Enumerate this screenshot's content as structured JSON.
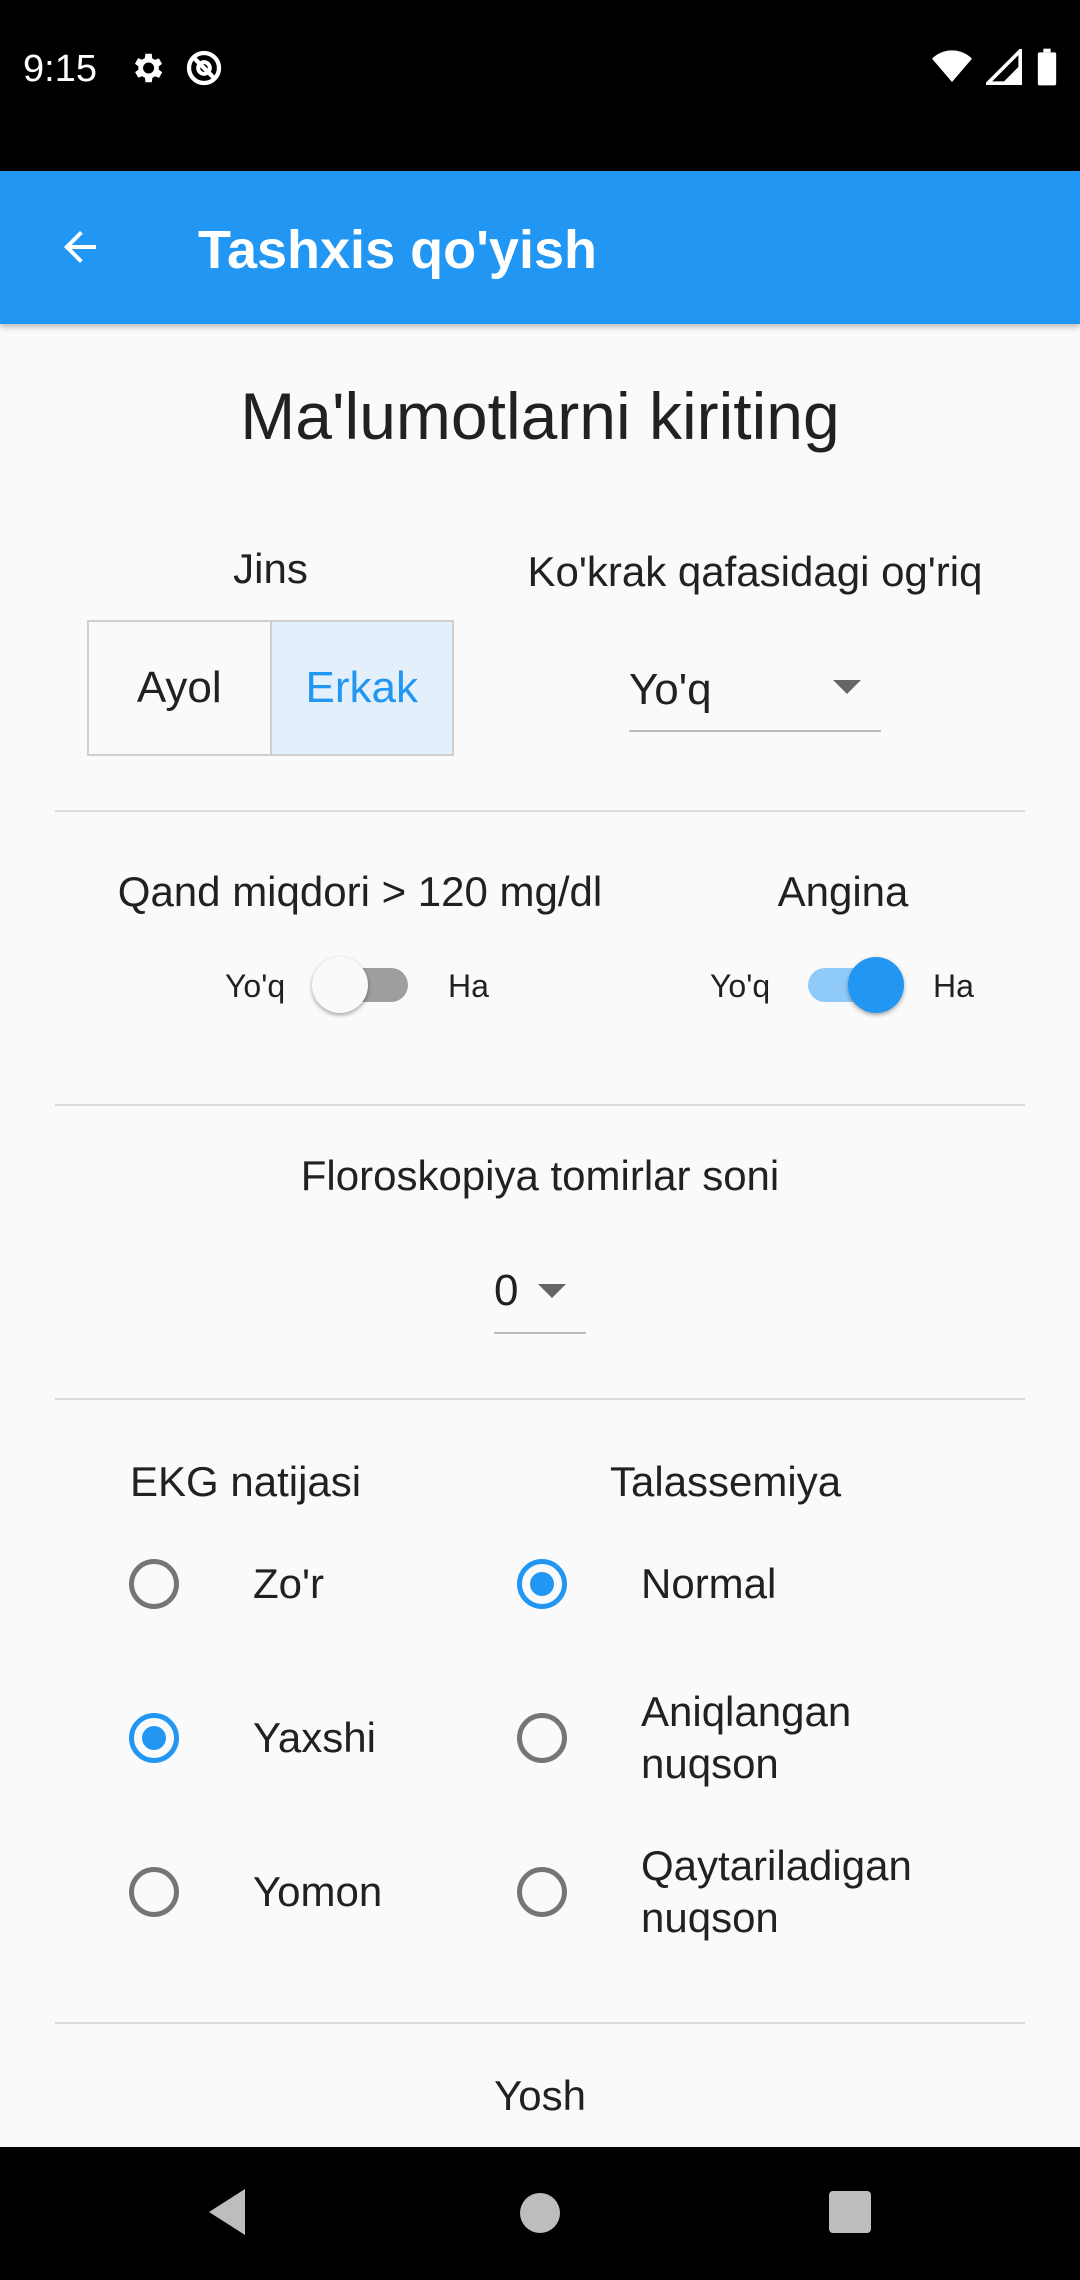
{
  "status_bar": {
    "time": "9:15"
  },
  "app_bar": {
    "title": "Tashxis qo'yish"
  },
  "heading": "Ma'lumotlarni kiriting",
  "gender": {
    "label": "Jins",
    "options": [
      "Ayol",
      "Erkak"
    ],
    "selected": "Erkak"
  },
  "chest_pain": {
    "label": "Ko'krak qafasidagi og'riq",
    "value": "Yo'q"
  },
  "sugar": {
    "label": "Qand miqdori > 120 mg/dl",
    "off_label": "Yo'q",
    "on_label": "Ha",
    "checked": false
  },
  "angina": {
    "label": "Angina",
    "off_label": "Yo'q",
    "on_label": "Ha",
    "checked": true
  },
  "vessels": {
    "label": "Floroskopiya tomirlar soni",
    "value": "0"
  },
  "ecg": {
    "label": "EKG natijasi",
    "options": [
      "Zo'r",
      "Yaxshi",
      "Yomon"
    ],
    "selected": "Yaxshi"
  },
  "thal": {
    "label": "Talassemiya",
    "options": [
      {
        "line1": "Normal",
        "line2": ""
      },
      {
        "line1": "Aniqlangan",
        "line2": "nuqson"
      },
      {
        "line1": "Qaytariladigan",
        "line2": "nuqson"
      }
    ],
    "selected": "Normal"
  },
  "age": {
    "label": "Yosh"
  },
  "colors": {
    "primary": "#2196f3",
    "switch_off_track": "#9e9e9e",
    "switch_on_track": "#90caf9"
  }
}
